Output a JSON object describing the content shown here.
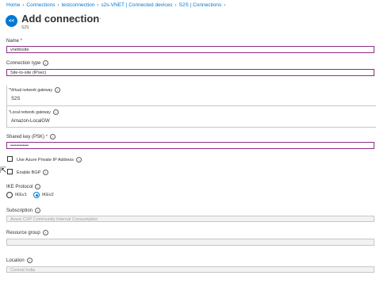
{
  "breadcrumb": [
    "Home",
    "Connections",
    "testconnection",
    "s2s-VNET | Connected devices",
    "S2S | Connections"
  ],
  "header": {
    "logo": "<<",
    "title": "Add connection",
    "more": "...",
    "subtitle": "S2S"
  },
  "form": {
    "name": {
      "label": "Name",
      "required": "*",
      "value": "vnettosite"
    },
    "connection_type": {
      "label": "Connection type",
      "value": "Site-to-site (IPsec)"
    },
    "virtual_network_gateway": {
      "label": "Virtual network gateway",
      "required": "*",
      "value": "S2S"
    },
    "local_network_gateway": {
      "label": "Local network gateway",
      "required": "*",
      "value": "Amazon-LocalGW"
    },
    "shared_key": {
      "label": "Shared key (PSK)",
      "required": "*",
      "value": "••••••••••••"
    },
    "use_private_ip": {
      "label": "Use Azure Private IP Address"
    },
    "enable_bgp": {
      "label": "Enable BGP"
    },
    "ike_protocol": {
      "label": "IKE Protocol",
      "options": [
        "IKEv1",
        "IKEv2"
      ],
      "selected": "IKEv2"
    },
    "subscription": {
      "label": "Subscription",
      "value": "Azure CXP Community Internal Consumption"
    },
    "resource_group": {
      "label": "Resource group"
    },
    "location": {
      "label": "Location",
      "value": "Central India"
    }
  },
  "icons": {
    "info": "info-icon",
    "cursor": "mouse-cursor-icon"
  },
  "colors": {
    "link": "#0078d4",
    "focus_border": "#8a2e86",
    "required": "#a4262c"
  }
}
